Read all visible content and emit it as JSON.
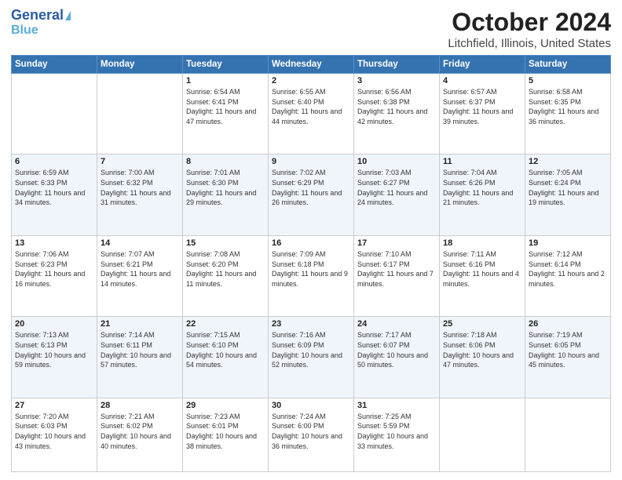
{
  "header": {
    "logo_line1": "General",
    "logo_line2": "Blue",
    "month": "October 2024",
    "location": "Litchfield, Illinois, United States"
  },
  "weekdays": [
    "Sunday",
    "Monday",
    "Tuesday",
    "Wednesday",
    "Thursday",
    "Friday",
    "Saturday"
  ],
  "rows": [
    [
      {
        "day": "",
        "info": ""
      },
      {
        "day": "",
        "info": ""
      },
      {
        "day": "1",
        "info": "Sunrise: 6:54 AM\nSunset: 6:41 PM\nDaylight: 11 hours and 47 minutes."
      },
      {
        "day": "2",
        "info": "Sunrise: 6:55 AM\nSunset: 6:40 PM\nDaylight: 11 hours and 44 minutes."
      },
      {
        "day": "3",
        "info": "Sunrise: 6:56 AM\nSunset: 6:38 PM\nDaylight: 11 hours and 42 minutes."
      },
      {
        "day": "4",
        "info": "Sunrise: 6:57 AM\nSunset: 6:37 PM\nDaylight: 11 hours and 39 minutes."
      },
      {
        "day": "5",
        "info": "Sunrise: 6:58 AM\nSunset: 6:35 PM\nDaylight: 11 hours and 36 minutes."
      }
    ],
    [
      {
        "day": "6",
        "info": "Sunrise: 6:59 AM\nSunset: 6:33 PM\nDaylight: 11 hours and 34 minutes."
      },
      {
        "day": "7",
        "info": "Sunrise: 7:00 AM\nSunset: 6:32 PM\nDaylight: 11 hours and 31 minutes."
      },
      {
        "day": "8",
        "info": "Sunrise: 7:01 AM\nSunset: 6:30 PM\nDaylight: 11 hours and 29 minutes."
      },
      {
        "day": "9",
        "info": "Sunrise: 7:02 AM\nSunset: 6:29 PM\nDaylight: 11 hours and 26 minutes."
      },
      {
        "day": "10",
        "info": "Sunrise: 7:03 AM\nSunset: 6:27 PM\nDaylight: 11 hours and 24 minutes."
      },
      {
        "day": "11",
        "info": "Sunrise: 7:04 AM\nSunset: 6:26 PM\nDaylight: 11 hours and 21 minutes."
      },
      {
        "day": "12",
        "info": "Sunrise: 7:05 AM\nSunset: 6:24 PM\nDaylight: 11 hours and 19 minutes."
      }
    ],
    [
      {
        "day": "13",
        "info": "Sunrise: 7:06 AM\nSunset: 6:23 PM\nDaylight: 11 hours and 16 minutes."
      },
      {
        "day": "14",
        "info": "Sunrise: 7:07 AM\nSunset: 6:21 PM\nDaylight: 11 hours and 14 minutes."
      },
      {
        "day": "15",
        "info": "Sunrise: 7:08 AM\nSunset: 6:20 PM\nDaylight: 11 hours and 11 minutes."
      },
      {
        "day": "16",
        "info": "Sunrise: 7:09 AM\nSunset: 6:18 PM\nDaylight: 11 hours and 9 minutes."
      },
      {
        "day": "17",
        "info": "Sunrise: 7:10 AM\nSunset: 6:17 PM\nDaylight: 11 hours and 7 minutes."
      },
      {
        "day": "18",
        "info": "Sunrise: 7:11 AM\nSunset: 6:16 PM\nDaylight: 11 hours and 4 minutes."
      },
      {
        "day": "19",
        "info": "Sunrise: 7:12 AM\nSunset: 6:14 PM\nDaylight: 11 hours and 2 minutes."
      }
    ],
    [
      {
        "day": "20",
        "info": "Sunrise: 7:13 AM\nSunset: 6:13 PM\nDaylight: 10 hours and 59 minutes."
      },
      {
        "day": "21",
        "info": "Sunrise: 7:14 AM\nSunset: 6:11 PM\nDaylight: 10 hours and 57 minutes."
      },
      {
        "day": "22",
        "info": "Sunrise: 7:15 AM\nSunset: 6:10 PM\nDaylight: 10 hours and 54 minutes."
      },
      {
        "day": "23",
        "info": "Sunrise: 7:16 AM\nSunset: 6:09 PM\nDaylight: 10 hours and 52 minutes."
      },
      {
        "day": "24",
        "info": "Sunrise: 7:17 AM\nSunset: 6:07 PM\nDaylight: 10 hours and 50 minutes."
      },
      {
        "day": "25",
        "info": "Sunrise: 7:18 AM\nSunset: 6:06 PM\nDaylight: 10 hours and 47 minutes."
      },
      {
        "day": "26",
        "info": "Sunrise: 7:19 AM\nSunset: 6:05 PM\nDaylight: 10 hours and 45 minutes."
      }
    ],
    [
      {
        "day": "27",
        "info": "Sunrise: 7:20 AM\nSunset: 6:03 PM\nDaylight: 10 hours and 43 minutes."
      },
      {
        "day": "28",
        "info": "Sunrise: 7:21 AM\nSunset: 6:02 PM\nDaylight: 10 hours and 40 minutes."
      },
      {
        "day": "29",
        "info": "Sunrise: 7:23 AM\nSunset: 6:01 PM\nDaylight: 10 hours and 38 minutes."
      },
      {
        "day": "30",
        "info": "Sunrise: 7:24 AM\nSunset: 6:00 PM\nDaylight: 10 hours and 36 minutes."
      },
      {
        "day": "31",
        "info": "Sunrise: 7:25 AM\nSunset: 5:59 PM\nDaylight: 10 hours and 33 minutes."
      },
      {
        "day": "",
        "info": ""
      },
      {
        "day": "",
        "info": ""
      }
    ]
  ]
}
